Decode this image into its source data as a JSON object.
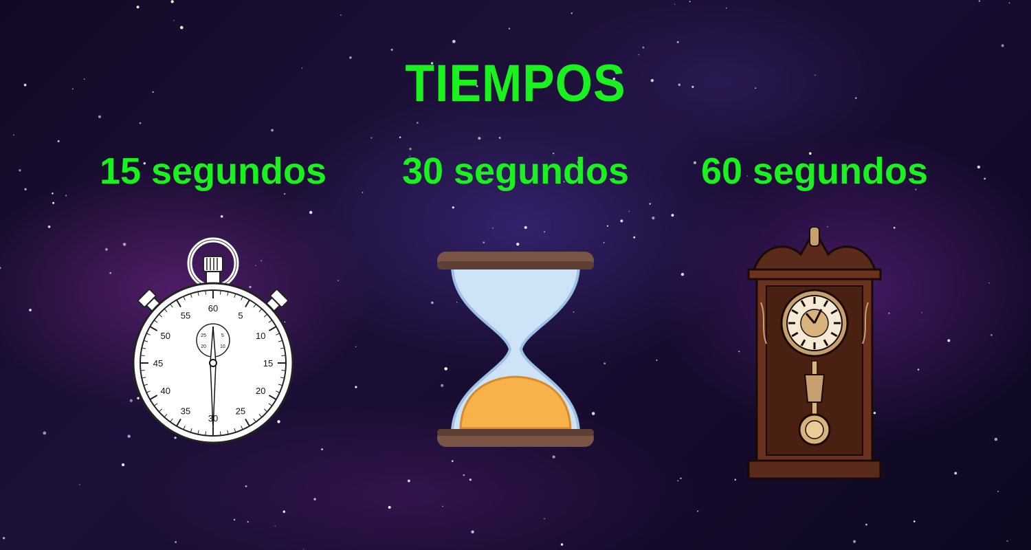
{
  "title": "TIEMPOS",
  "options": [
    {
      "label": "15 segundos",
      "icon": "stopwatch-icon"
    },
    {
      "label": "30 segundos",
      "icon": "hourglass-icon"
    },
    {
      "label": "60 segundos",
      "icon": "pendulum-clock-icon"
    }
  ],
  "stopwatch_dial": [
    "60",
    "5",
    "10",
    "15",
    "20",
    "25",
    "30",
    "35",
    "40",
    "45",
    "50",
    "55"
  ],
  "stopwatch_subdial": [
    "5",
    "10",
    "15",
    "20",
    "25"
  ],
  "colors": {
    "accent": "#19f21e",
    "sand": "#f7b24a",
    "hourglass_frame": "#7a5545",
    "clock_wood": "#5a2a1a"
  }
}
